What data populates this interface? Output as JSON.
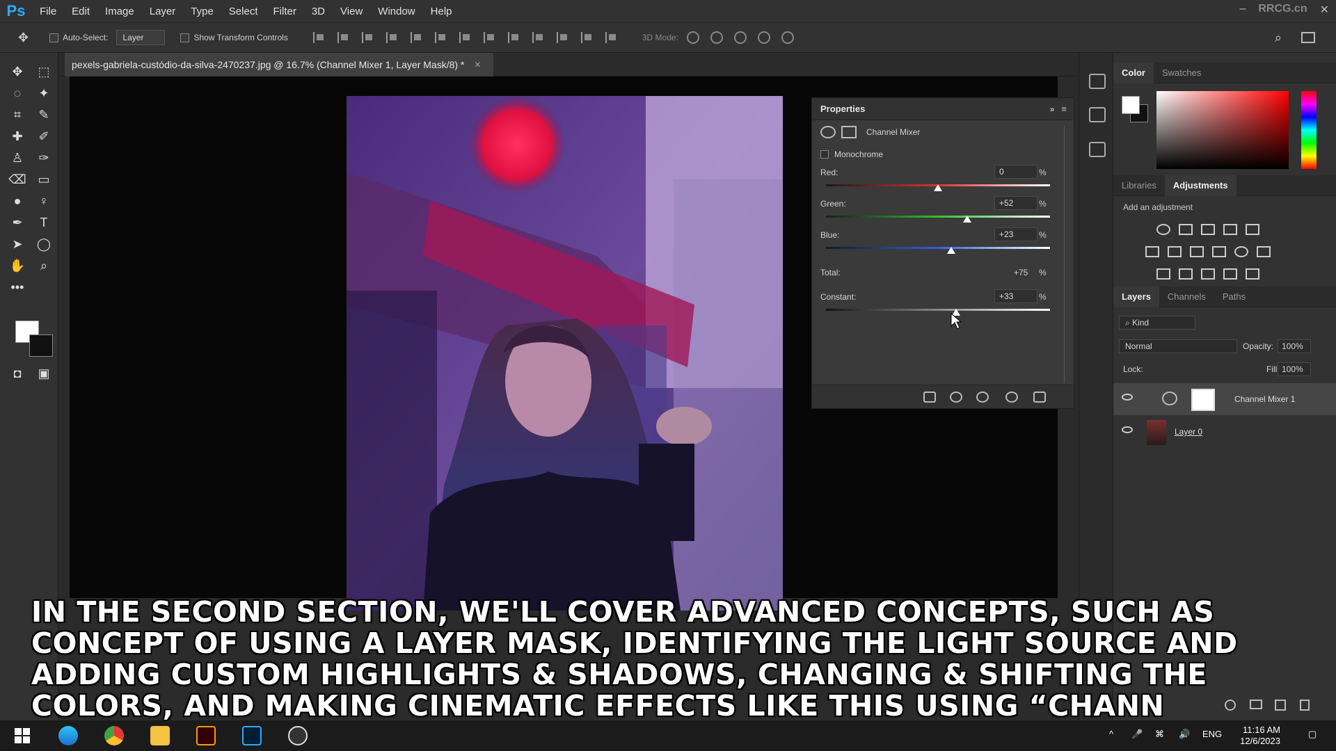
{
  "app": {
    "logo": "Ps",
    "watermark": "RRCG.cn"
  },
  "menu": [
    "File",
    "Edit",
    "Image",
    "Layer",
    "Type",
    "Select",
    "Filter",
    "3D",
    "View",
    "Window",
    "Help"
  ],
  "options": {
    "auto_select_label": "Auto-Select:",
    "auto_select_value": "Layer",
    "transform_label": "Show Transform Controls",
    "mode_3d_label": "3D Mode:"
  },
  "document": {
    "tab_title": "pexels-gabriela-custódio-da-silva-2470237.jpg @ 16.7% (Channel Mixer 1, Layer Mask/8) *",
    "zoom_label": "16.7%"
  },
  "properties": {
    "title": "Properties",
    "adjustment_name": "Channel Mixer",
    "monochrome_label": "Monochrome",
    "sliders": [
      {
        "label": "Red:",
        "value": "0",
        "percent": "%",
        "position": 0.5,
        "color": "#e03030"
      },
      {
        "label": "Green:",
        "value": "+52",
        "percent": "%",
        "position": 0.63,
        "color": "#30c030"
      },
      {
        "label": "Blue:",
        "value": "+23",
        "percent": "%",
        "position": 0.56,
        "color": "#3060e0"
      }
    ],
    "total_label": "Total:",
    "total_value": "+75",
    "total_percent": "%",
    "constant_label": "Constant:",
    "constant_value": "+33",
    "constant_percent": "%",
    "constant_position": 0.58
  },
  "color_panel": {
    "tabs": [
      "Color",
      "Swatches"
    ]
  },
  "adjust_panel": {
    "tabs": [
      "Libraries",
      "Adjustments"
    ],
    "add_label": "Add an adjustment"
  },
  "layers_panel": {
    "tabs": [
      "Layers",
      "Channels",
      "Paths"
    ],
    "filter_kind": "Kind",
    "blend_mode": "Normal",
    "opacity_label": "Opacity:",
    "opacity_value": "100%",
    "lock_label": "Lock:",
    "fill_label": "Fill:",
    "fill_value": "100%",
    "layers": [
      {
        "name": "Channel Mixer 1"
      },
      {
        "name": "Layer 0"
      }
    ]
  },
  "caption": {
    "lines": [
      "IN THE SECOND SECTION, WE'LL COVER ADVANCED CONCEPTS, SUCH AS",
      "CONCEPT OF USING A LAYER MASK, IDENTIFYING THE LIGHT SOURCE AND",
      "ADDING CUSTOM HIGHLIGHTS & SHADOWS, CHANGING & SHIFTING THE",
      "COLORS, AND MAKING CINEMATIC EFFECTS LIKE THIS USING “CHANN"
    ]
  },
  "taskbar": {
    "lang": "ENG",
    "time": "11:16 AM",
    "date": "12/6/2023",
    "apps": [
      "windows-start",
      "edge",
      "chrome",
      "file-explorer",
      "illustrator",
      "photoshop",
      "obs"
    ]
  }
}
